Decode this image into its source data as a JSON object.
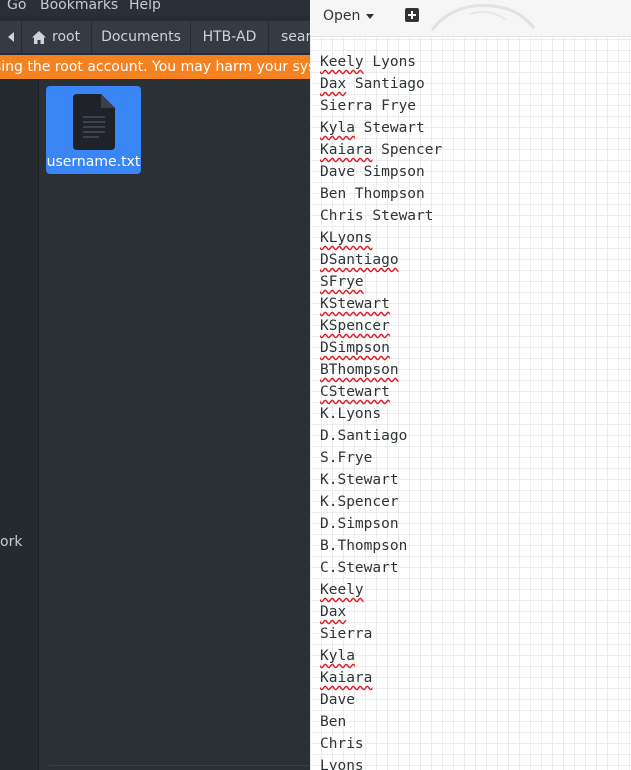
{
  "file_manager": {
    "menu": [
      "Go",
      "Bookmarks",
      "Help"
    ],
    "breadcrumbs": [
      "root",
      "Documents",
      "HTB-AD",
      "sear"
    ],
    "warning": "sing the root account. You may harm your system",
    "sidebar_label": "ork",
    "file": {
      "name": "username.txt"
    }
  },
  "editor": {
    "open_label": "Open",
    "lines": [
      {
        "parts": [
          {
            "t": "Keely",
            "sp": true
          },
          {
            "t": " Lyons"
          }
        ]
      },
      {
        "parts": [
          {
            "t": "Dax",
            "sp": true
          },
          {
            "t": " Santiago"
          }
        ]
      },
      {
        "parts": [
          {
            "t": "Sierra Frye"
          }
        ]
      },
      {
        "parts": [
          {
            "t": "Kyla",
            "sp": true
          },
          {
            "t": " Stewart"
          }
        ]
      },
      {
        "parts": [
          {
            "t": "Kaiara",
            "sp": true
          },
          {
            "t": " Spencer"
          }
        ]
      },
      {
        "parts": [
          {
            "t": "Dave Simpson"
          }
        ]
      },
      {
        "parts": [
          {
            "t": "Ben Thompson"
          }
        ]
      },
      {
        "parts": [
          {
            "t": "Chris Stewart"
          }
        ]
      },
      {
        "parts": [
          {
            "t": "KLyons",
            "sp": true
          }
        ]
      },
      {
        "parts": [
          {
            "t": "DSantiago",
            "sp": true
          }
        ]
      },
      {
        "parts": [
          {
            "t": "SFrye",
            "sp": true
          }
        ]
      },
      {
        "parts": [
          {
            "t": "KStewart",
            "sp": true
          }
        ]
      },
      {
        "parts": [
          {
            "t": "KSpencer",
            "sp": true
          }
        ]
      },
      {
        "parts": [
          {
            "t": "DSimpson",
            "sp": true
          }
        ]
      },
      {
        "parts": [
          {
            "t": "BThompson",
            "sp": true
          }
        ]
      },
      {
        "parts": [
          {
            "t": "CStewart",
            "sp": true
          }
        ]
      },
      {
        "parts": [
          {
            "t": "K.Lyons"
          }
        ]
      },
      {
        "parts": [
          {
            "t": "D.Santiago"
          }
        ]
      },
      {
        "parts": [
          {
            "t": "S.Frye"
          }
        ]
      },
      {
        "parts": [
          {
            "t": "K.Stewart"
          }
        ]
      },
      {
        "parts": [
          {
            "t": "K.Spencer"
          }
        ]
      },
      {
        "parts": [
          {
            "t": "D.Simpson"
          }
        ]
      },
      {
        "parts": [
          {
            "t": "B.Thompson"
          }
        ]
      },
      {
        "parts": [
          {
            "t": "C.Stewart"
          }
        ]
      },
      {
        "parts": [
          {
            "t": "Keely",
            "sp": true
          }
        ]
      },
      {
        "parts": [
          {
            "t": "Dax",
            "sp": true
          }
        ]
      },
      {
        "parts": [
          {
            "t": "Sierra"
          }
        ]
      },
      {
        "parts": [
          {
            "t": "Kyla",
            "sp": true
          }
        ]
      },
      {
        "parts": [
          {
            "t": "Kaiara",
            "sp": true
          }
        ]
      },
      {
        "parts": [
          {
            "t": "Dave"
          }
        ]
      },
      {
        "parts": [
          {
            "t": "Ben"
          }
        ]
      },
      {
        "parts": [
          {
            "t": "Chris"
          }
        ]
      },
      {
        "parts": [
          {
            "t": "Lyons"
          }
        ]
      }
    ]
  }
}
